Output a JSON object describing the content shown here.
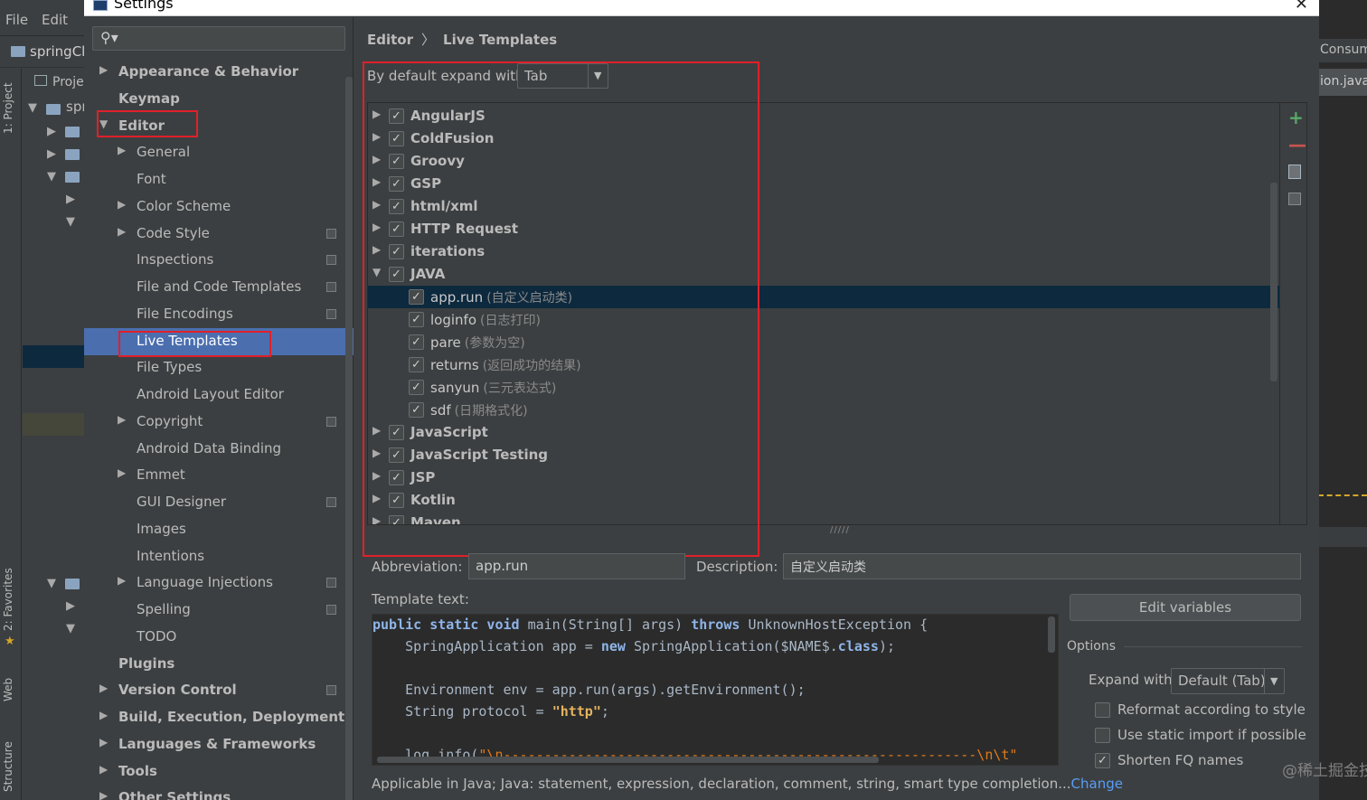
{
  "background_ide": {
    "menu": [
      "File",
      "Edit"
    ],
    "project_label": "springCl",
    "tree_labels": [
      "Proje",
      "spr"
    ],
    "side_tabs": [
      "1: Project",
      "2: Favorites",
      "Web",
      "Structure"
    ],
    "right_tabs": [
      "Consum",
      "ion.java"
    ]
  },
  "dialog": {
    "title": "Settings",
    "close_symbol": "✕"
  },
  "settings_tree": {
    "search_icon": "🔍︎",
    "items": [
      {
        "label": "Appearance & Behavior",
        "level": 0,
        "arrow": "▶",
        "bold": true
      },
      {
        "label": "Keymap",
        "level": 0,
        "arrow": "",
        "bold": true
      },
      {
        "label": "Editor",
        "level": 0,
        "arrow": "▼",
        "bold": true
      },
      {
        "label": "General",
        "level": 1,
        "arrow": "▶"
      },
      {
        "label": "Font",
        "level": 1,
        "arrow": ""
      },
      {
        "label": "Color Scheme",
        "level": 1,
        "arrow": "▶"
      },
      {
        "label": "Code Style",
        "level": 1,
        "arrow": "▶",
        "copy": true
      },
      {
        "label": "Inspections",
        "level": 1,
        "arrow": "",
        "copy": true
      },
      {
        "label": "File and Code Templates",
        "level": 1,
        "arrow": "",
        "copy": true
      },
      {
        "label": "File Encodings",
        "level": 1,
        "arrow": "",
        "copy": true
      },
      {
        "label": "Live Templates",
        "level": 1,
        "arrow": "",
        "selected": true
      },
      {
        "label": "File Types",
        "level": 1,
        "arrow": ""
      },
      {
        "label": "Android Layout Editor",
        "level": 1,
        "arrow": ""
      },
      {
        "label": "Copyright",
        "level": 1,
        "arrow": "▶",
        "copy": true
      },
      {
        "label": "Android Data Binding",
        "level": 1,
        "arrow": ""
      },
      {
        "label": "Emmet",
        "level": 1,
        "arrow": "▶"
      },
      {
        "label": "GUI Designer",
        "level": 1,
        "arrow": "",
        "copy": true
      },
      {
        "label": "Images",
        "level": 1,
        "arrow": ""
      },
      {
        "label": "Intentions",
        "level": 1,
        "arrow": ""
      },
      {
        "label": "Language Injections",
        "level": 1,
        "arrow": "▶",
        "copy": true
      },
      {
        "label": "Spelling",
        "level": 1,
        "arrow": "",
        "copy": true
      },
      {
        "label": "TODO",
        "level": 1,
        "arrow": ""
      },
      {
        "label": "Plugins",
        "level": 0,
        "arrow": "",
        "bold": true
      },
      {
        "label": "Version Control",
        "level": 0,
        "arrow": "▶",
        "bold": true,
        "copy": true
      },
      {
        "label": "Build, Execution, Deployment",
        "level": 0,
        "arrow": "▶",
        "bold": true
      },
      {
        "label": "Languages & Frameworks",
        "level": 0,
        "arrow": "▶",
        "bold": true
      },
      {
        "label": "Tools",
        "level": 0,
        "arrow": "▶",
        "bold": true
      },
      {
        "label": "Other Settings",
        "level": 0,
        "arrow": "▶",
        "bold": true
      }
    ]
  },
  "breadcrumb": {
    "parent": "Editor",
    "separator": "〉",
    "current": "Live Templates"
  },
  "expand_default": {
    "label": "By default expand with",
    "value": "Tab",
    "dropdown_symbol": "▼"
  },
  "template_groups": [
    {
      "type": "group",
      "name": "AngularJS",
      "arrow": "▶",
      "checked": true
    },
    {
      "type": "group",
      "name": "ColdFusion",
      "arrow": "▶",
      "checked": true
    },
    {
      "type": "group",
      "name": "Groovy",
      "arrow": "▶",
      "checked": true
    },
    {
      "type": "group",
      "name": "GSP",
      "arrow": "▶",
      "checked": true
    },
    {
      "type": "group",
      "name": "html/xml",
      "arrow": "▶",
      "checked": true
    },
    {
      "type": "group",
      "name": "HTTP Request",
      "arrow": "▶",
      "checked": true
    },
    {
      "type": "group",
      "name": "iterations",
      "arrow": "▶",
      "checked": true
    },
    {
      "type": "group",
      "name": "JAVA",
      "arrow": "▼",
      "checked": true
    },
    {
      "type": "live",
      "name": "app.run",
      "desc": "(自定义启动类)",
      "checked": true,
      "selected": true
    },
    {
      "type": "live",
      "name": "loginfo",
      "desc": "(日志打印)",
      "checked": true
    },
    {
      "type": "live",
      "name": "pare",
      "desc": "(参数为空)",
      "checked": true
    },
    {
      "type": "live",
      "name": "returns",
      "desc": "(返回成功的结果)",
      "checked": true
    },
    {
      "type": "live",
      "name": "sanyun",
      "desc": "(三元表达式)",
      "checked": true
    },
    {
      "type": "live",
      "name": "sdf",
      "desc": "(日期格式化)",
      "checked": true
    },
    {
      "type": "group",
      "name": "JavaScript",
      "arrow": "▶",
      "checked": true
    },
    {
      "type": "group",
      "name": "JavaScript Testing",
      "arrow": "▶",
      "checked": true
    },
    {
      "type": "group",
      "name": "JSP",
      "arrow": "▶",
      "checked": true
    },
    {
      "type": "group",
      "name": "Kotlin",
      "arrow": "▶",
      "checked": true
    },
    {
      "type": "group",
      "name": "Maven",
      "arrow": "▶",
      "checked": true
    }
  ],
  "checkmark": "✓",
  "toolbar": {
    "add": "+",
    "remove": "—"
  },
  "splitter": "/////",
  "abbreviation": {
    "label": "Abbreviation:",
    "value": "app.run"
  },
  "description": {
    "label": "Description:",
    "value": "自定义启动类"
  },
  "template_text_label": "Template text:",
  "code_lines": [
    [
      [
        "kw",
        "public static void "
      ],
      [
        "plain",
        "main(String[] args) "
      ],
      [
        "kw",
        "throws "
      ],
      [
        "plain",
        "UnknownHostException {"
      ]
    ],
    [
      [
        "plain",
        "    SpringApplication app = "
      ],
      [
        "kw",
        "new "
      ],
      [
        "plain",
        "SpringApplication($NAME$."
      ],
      [
        "kw",
        "class"
      ],
      [
        "plain",
        ");"
      ]
    ],
    [
      [
        "plain",
        ""
      ]
    ],
    [
      [
        "plain",
        "    Environment env = app.run(args).getEnvironment();"
      ]
    ],
    [
      [
        "plain",
        "    String protocol = "
      ],
      [
        "str",
        "\"http\""
      ],
      [
        "plain",
        ";"
      ]
    ],
    [
      [
        "plain",
        ""
      ]
    ],
    [
      [
        "plain",
        "    log.info("
      ],
      [
        "str2",
        "\"\\n----------------------------------------------------------\\n\\t\""
      ]
    ]
  ],
  "edit_variables_label": "Edit variables",
  "options": {
    "title": "Options",
    "expand_with_label": "Expand with",
    "expand_with_value": "Default (Tab)",
    "checkboxes": [
      {
        "label": "Reformat according to style",
        "checked": false
      },
      {
        "label": "Use static import if possible",
        "checked": false
      },
      {
        "label": "Shorten FQ names",
        "checked": true
      }
    ]
  },
  "applicable": {
    "text": "Applicable in Java; Java: statement, expression, declaration, comment, string, smart type completion...",
    "link": "Change"
  },
  "watermark": "@稀土掘金技术社区",
  "colors": {
    "accent_selection": "#4b6eaf",
    "annotation_red": "#e0202a",
    "dark_selection": "#0d293e",
    "link": "#589df6",
    "add_green": "#59a869"
  }
}
